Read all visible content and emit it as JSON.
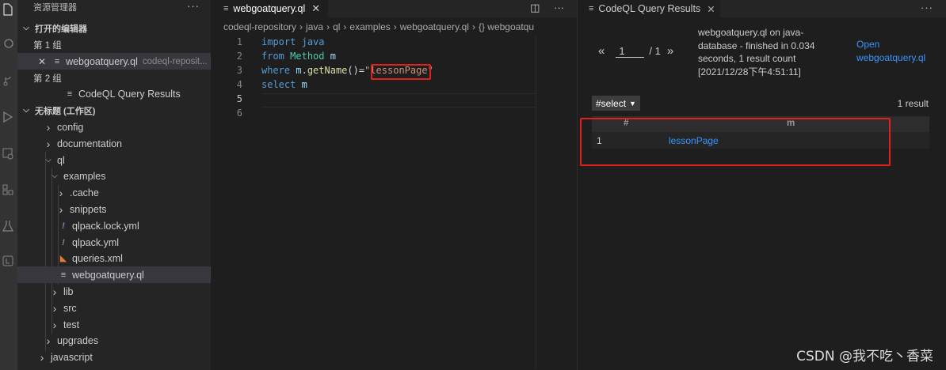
{
  "explorer": {
    "title": "资源管理器",
    "more": "···",
    "open_editors_label": "打开的编辑器",
    "group1_label": "第 1 组",
    "group1_file": "webgoatquery.ql",
    "group1_file_path": "codeql-reposit...",
    "group1_close": "✕",
    "group2_label": "第 2 组",
    "group2_file": "CodeQL Query Results",
    "workspace_label": "无标题 (工作区)",
    "tree": [
      {
        "label": "config",
        "kind": "folder",
        "depth": 1
      },
      {
        "label": "documentation",
        "kind": "folder",
        "depth": 1
      },
      {
        "label": "ql",
        "kind": "folder-open",
        "depth": 1
      },
      {
        "label": "examples",
        "kind": "folder-open",
        "depth": 2
      },
      {
        "label": ".cache",
        "kind": "folder",
        "depth": 3
      },
      {
        "label": "snippets",
        "kind": "folder",
        "depth": 3
      },
      {
        "label": "qlpack.lock.yml",
        "kind": "yml",
        "depth": 3
      },
      {
        "label": "qlpack.yml",
        "kind": "yml",
        "depth": 3
      },
      {
        "label": "queries.xml",
        "kind": "xml",
        "depth": 3
      },
      {
        "label": "webgoatquery.ql",
        "kind": "ql",
        "depth": 3,
        "selected": true
      },
      {
        "label": "lib",
        "kind": "folder",
        "depth": 2
      },
      {
        "label": "src",
        "kind": "folder",
        "depth": 2
      },
      {
        "label": "test",
        "kind": "folder",
        "depth": 2
      },
      {
        "label": "upgrades",
        "kind": "folder",
        "depth": 1
      },
      {
        "label": "javascript",
        "kind": "folder",
        "depth": 0
      }
    ]
  },
  "editor": {
    "tab_label": "webgoatquery.ql",
    "tab_close": "✕",
    "breadcrumb": [
      "codeql-repository",
      "java",
      "ql",
      "examples",
      "webgoatquery.ql",
      "{} webgoatqu"
    ],
    "lines": [
      {
        "n": "1",
        "t": [
          [
            "kw",
            "import"
          ],
          [
            "pl",
            " "
          ],
          [
            "kw",
            "java"
          ]
        ]
      },
      {
        "n": "2",
        "t": [
          [
            "kw",
            "from"
          ],
          [
            "pl",
            " "
          ],
          [
            "ty",
            "Method"
          ],
          [
            "pl",
            " "
          ],
          [
            "vr",
            "m"
          ]
        ]
      },
      {
        "n": "3",
        "t": [
          [
            "kw",
            "where"
          ],
          [
            "pl",
            " "
          ],
          [
            "vr",
            "m"
          ],
          [
            "pl",
            "."
          ],
          [
            "fn",
            "getName"
          ],
          [
            "pl",
            "()="
          ],
          [
            "st",
            "\"lessonPage\""
          ]
        ]
      },
      {
        "n": "4",
        "t": [
          [
            "kw",
            "select"
          ],
          [
            "pl",
            " "
          ],
          [
            "vr",
            "m"
          ]
        ]
      },
      {
        "n": "5",
        "t": []
      },
      {
        "n": "6",
        "t": []
      }
    ],
    "active_line": "5"
  },
  "results": {
    "tab_label": "CodeQL Query Results",
    "tab_close": "✕",
    "more": "···",
    "prev": "«",
    "page_value": "1",
    "page_total": "/ 1",
    "next": "»",
    "summary": "webgoatquery.ql on java-database - finished in 0.034 seconds, 1 result count [2021/12/28下午4:51:11]",
    "open_link": "Open webgoatquery.ql",
    "select_label": "#select",
    "result_count": "1 result",
    "columns": [
      "#",
      "m"
    ],
    "rows": [
      {
        "index": "1",
        "value": "lessonPage"
      }
    ]
  },
  "watermark": "CSDN @我不吃丶香菜",
  "colors": {
    "highlight_box": "#e0201c",
    "link": "#3794ff"
  }
}
